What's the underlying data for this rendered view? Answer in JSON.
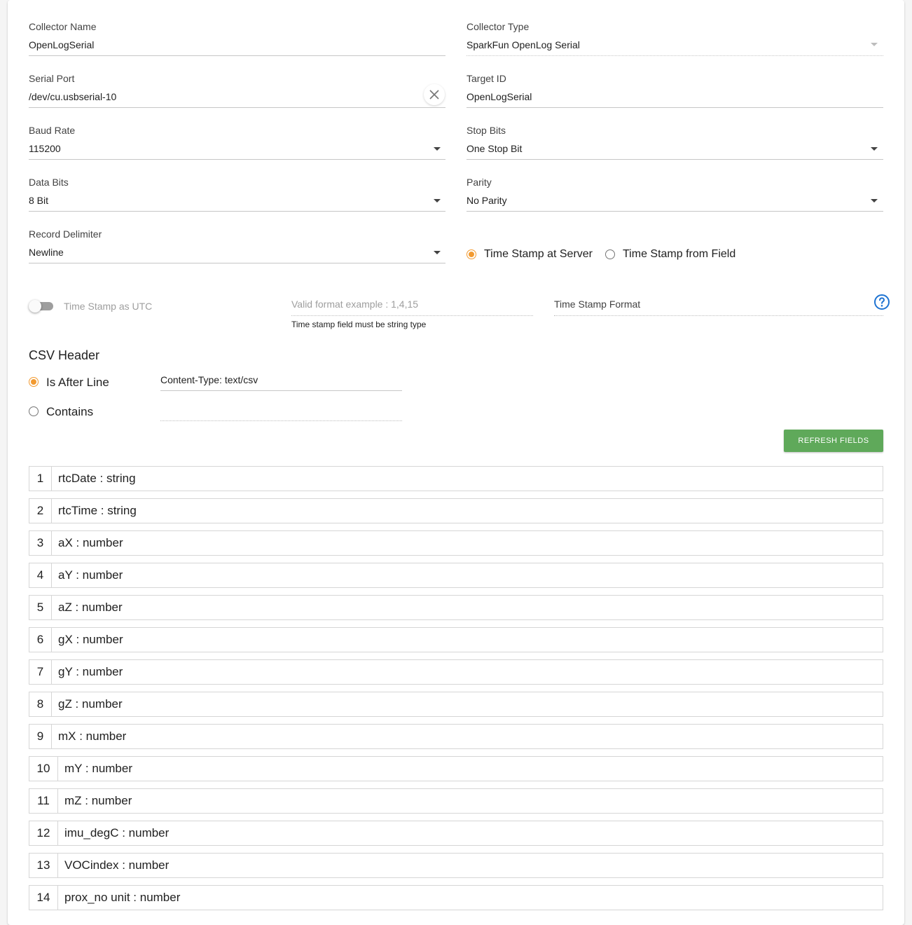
{
  "form": {
    "collector_name": {
      "label": "Collector Name",
      "value": "OpenLogSerial"
    },
    "collector_type": {
      "label": "Collector Type",
      "value": "SparkFun OpenLog Serial"
    },
    "serial_port": {
      "label": "Serial Port",
      "value": "/dev/cu.usbserial-10"
    },
    "target_id": {
      "label": "Target ID",
      "value": "OpenLogSerial"
    },
    "baud_rate": {
      "label": "Baud Rate",
      "value": "115200"
    },
    "stop_bits": {
      "label": "Stop Bits",
      "value": "One Stop Bit"
    },
    "data_bits": {
      "label": "Data Bits",
      "value": "8 Bit"
    },
    "parity": {
      "label": "Parity",
      "value": "No Parity"
    },
    "record_delimiter": {
      "label": "Record Delimiter",
      "value": "Newline"
    }
  },
  "timestamp": {
    "at_server_label": "Time Stamp at Server",
    "from_field_label": "Time Stamp from Field",
    "selected": "server",
    "utc_label": "Time Stamp as UTC",
    "utc_enabled": false,
    "field_placeholder": "Valid format example : 1,4,15",
    "field_hint": "Time stamp field must be string type",
    "format_placeholder": "Time Stamp Format",
    "help_icon": "help-circle-icon"
  },
  "csv_header": {
    "title": "CSV Header",
    "is_after_line_label": "Is After Line",
    "contains_label": "Contains",
    "selected": "is_after_line",
    "after_line_value": "Content-Type: text/csv",
    "contains_value": ""
  },
  "refresh_button": "REFRESH FIELDS",
  "fields": [
    {
      "index": "1",
      "name": "rtcDate : string"
    },
    {
      "index": "2",
      "name": "rtcTime : string"
    },
    {
      "index": "3",
      "name": "aX : number"
    },
    {
      "index": "4",
      "name": "aY : number"
    },
    {
      "index": "5",
      "name": "aZ : number"
    },
    {
      "index": "6",
      "name": "gX : number"
    },
    {
      "index": "7",
      "name": "gY : number"
    },
    {
      "index": "8",
      "name": "gZ : number"
    },
    {
      "index": "9",
      "name": "mX : number"
    },
    {
      "index": "10",
      "name": "mY : number"
    },
    {
      "index": "11",
      "name": "mZ : number"
    },
    {
      "index": "12",
      "name": "imu_degC : number"
    },
    {
      "index": "13",
      "name": "VOCindex : number"
    },
    {
      "index": "14",
      "name": "prox_no unit : number"
    }
  ],
  "colors": {
    "accent_orange": "#f29a30",
    "button_green": "#5fa95a",
    "help_blue": "#1e73d2"
  }
}
